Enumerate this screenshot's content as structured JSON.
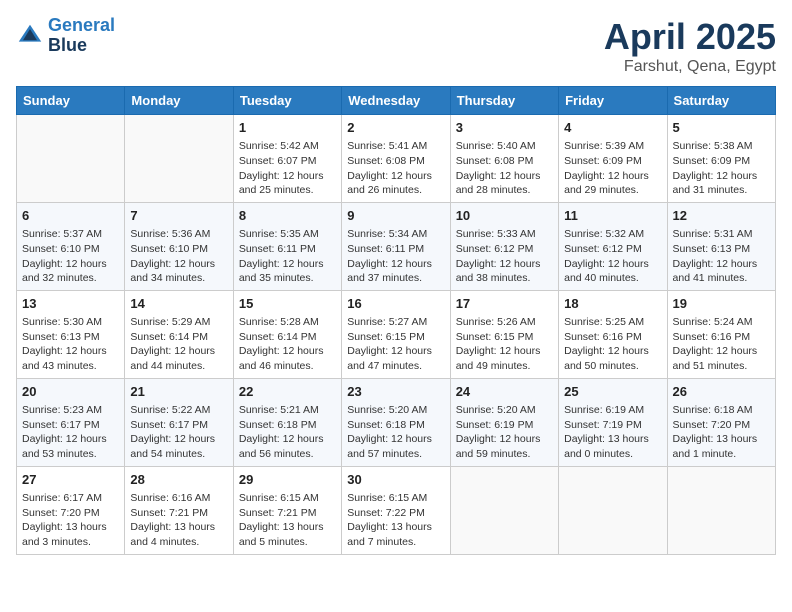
{
  "logo": {
    "line1": "General",
    "line2": "Blue"
  },
  "title": "April 2025",
  "location": "Farshut, Qena, Egypt",
  "weekdays": [
    "Sunday",
    "Monday",
    "Tuesday",
    "Wednesday",
    "Thursday",
    "Friday",
    "Saturday"
  ],
  "weeks": [
    [
      {
        "day": "",
        "info": ""
      },
      {
        "day": "",
        "info": ""
      },
      {
        "day": "1",
        "info": "Sunrise: 5:42 AM\nSunset: 6:07 PM\nDaylight: 12 hours\nand 25 minutes."
      },
      {
        "day": "2",
        "info": "Sunrise: 5:41 AM\nSunset: 6:08 PM\nDaylight: 12 hours\nand 26 minutes."
      },
      {
        "day": "3",
        "info": "Sunrise: 5:40 AM\nSunset: 6:08 PM\nDaylight: 12 hours\nand 28 minutes."
      },
      {
        "day": "4",
        "info": "Sunrise: 5:39 AM\nSunset: 6:09 PM\nDaylight: 12 hours\nand 29 minutes."
      },
      {
        "day": "5",
        "info": "Sunrise: 5:38 AM\nSunset: 6:09 PM\nDaylight: 12 hours\nand 31 minutes."
      }
    ],
    [
      {
        "day": "6",
        "info": "Sunrise: 5:37 AM\nSunset: 6:10 PM\nDaylight: 12 hours\nand 32 minutes."
      },
      {
        "day": "7",
        "info": "Sunrise: 5:36 AM\nSunset: 6:10 PM\nDaylight: 12 hours\nand 34 minutes."
      },
      {
        "day": "8",
        "info": "Sunrise: 5:35 AM\nSunset: 6:11 PM\nDaylight: 12 hours\nand 35 minutes."
      },
      {
        "day": "9",
        "info": "Sunrise: 5:34 AM\nSunset: 6:11 PM\nDaylight: 12 hours\nand 37 minutes."
      },
      {
        "day": "10",
        "info": "Sunrise: 5:33 AM\nSunset: 6:12 PM\nDaylight: 12 hours\nand 38 minutes."
      },
      {
        "day": "11",
        "info": "Sunrise: 5:32 AM\nSunset: 6:12 PM\nDaylight: 12 hours\nand 40 minutes."
      },
      {
        "day": "12",
        "info": "Sunrise: 5:31 AM\nSunset: 6:13 PM\nDaylight: 12 hours\nand 41 minutes."
      }
    ],
    [
      {
        "day": "13",
        "info": "Sunrise: 5:30 AM\nSunset: 6:13 PM\nDaylight: 12 hours\nand 43 minutes."
      },
      {
        "day": "14",
        "info": "Sunrise: 5:29 AM\nSunset: 6:14 PM\nDaylight: 12 hours\nand 44 minutes."
      },
      {
        "day": "15",
        "info": "Sunrise: 5:28 AM\nSunset: 6:14 PM\nDaylight: 12 hours\nand 46 minutes."
      },
      {
        "day": "16",
        "info": "Sunrise: 5:27 AM\nSunset: 6:15 PM\nDaylight: 12 hours\nand 47 minutes."
      },
      {
        "day": "17",
        "info": "Sunrise: 5:26 AM\nSunset: 6:15 PM\nDaylight: 12 hours\nand 49 minutes."
      },
      {
        "day": "18",
        "info": "Sunrise: 5:25 AM\nSunset: 6:16 PM\nDaylight: 12 hours\nand 50 minutes."
      },
      {
        "day": "19",
        "info": "Sunrise: 5:24 AM\nSunset: 6:16 PM\nDaylight: 12 hours\nand 51 minutes."
      }
    ],
    [
      {
        "day": "20",
        "info": "Sunrise: 5:23 AM\nSunset: 6:17 PM\nDaylight: 12 hours\nand 53 minutes."
      },
      {
        "day": "21",
        "info": "Sunrise: 5:22 AM\nSunset: 6:17 PM\nDaylight: 12 hours\nand 54 minutes."
      },
      {
        "day": "22",
        "info": "Sunrise: 5:21 AM\nSunset: 6:18 PM\nDaylight: 12 hours\nand 56 minutes."
      },
      {
        "day": "23",
        "info": "Sunrise: 5:20 AM\nSunset: 6:18 PM\nDaylight: 12 hours\nand 57 minutes."
      },
      {
        "day": "24",
        "info": "Sunrise: 5:20 AM\nSunset: 6:19 PM\nDaylight: 12 hours\nand 59 minutes."
      },
      {
        "day": "25",
        "info": "Sunrise: 6:19 AM\nSunset: 7:19 PM\nDaylight: 13 hours\nand 0 minutes."
      },
      {
        "day": "26",
        "info": "Sunrise: 6:18 AM\nSunset: 7:20 PM\nDaylight: 13 hours\nand 1 minute."
      }
    ],
    [
      {
        "day": "27",
        "info": "Sunrise: 6:17 AM\nSunset: 7:20 PM\nDaylight: 13 hours\nand 3 minutes."
      },
      {
        "day": "28",
        "info": "Sunrise: 6:16 AM\nSunset: 7:21 PM\nDaylight: 13 hours\nand 4 minutes."
      },
      {
        "day": "29",
        "info": "Sunrise: 6:15 AM\nSunset: 7:21 PM\nDaylight: 13 hours\nand 5 minutes."
      },
      {
        "day": "30",
        "info": "Sunrise: 6:15 AM\nSunset: 7:22 PM\nDaylight: 13 hours\nand 7 minutes."
      },
      {
        "day": "",
        "info": ""
      },
      {
        "day": "",
        "info": ""
      },
      {
        "day": "",
        "info": ""
      }
    ]
  ]
}
